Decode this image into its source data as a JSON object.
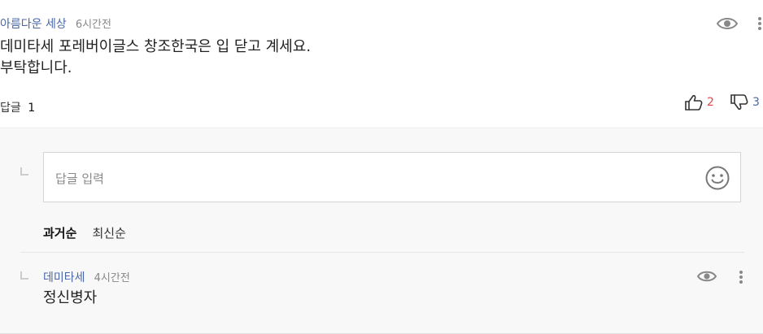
{
  "comment": {
    "author": "아름다운 세상",
    "time": "6시간전",
    "text_line1": "데미타세 포레버이글스 창조한국은 입 닫고 계세요.",
    "text_line2": "부탁합니다.",
    "reply_label": "답글",
    "reply_count": "1",
    "like_count": "2",
    "dislike_count": "3"
  },
  "reply_box": {
    "placeholder": "답글 입력"
  },
  "sort": {
    "oldest": "과거순",
    "newest": "최신순"
  },
  "reply": {
    "author": "데미타세",
    "time": "4시간전",
    "text": "정신병자"
  },
  "colors": {
    "author": "#4a67a8",
    "like": "#e04a4a",
    "dislike": "#4a67a8"
  }
}
